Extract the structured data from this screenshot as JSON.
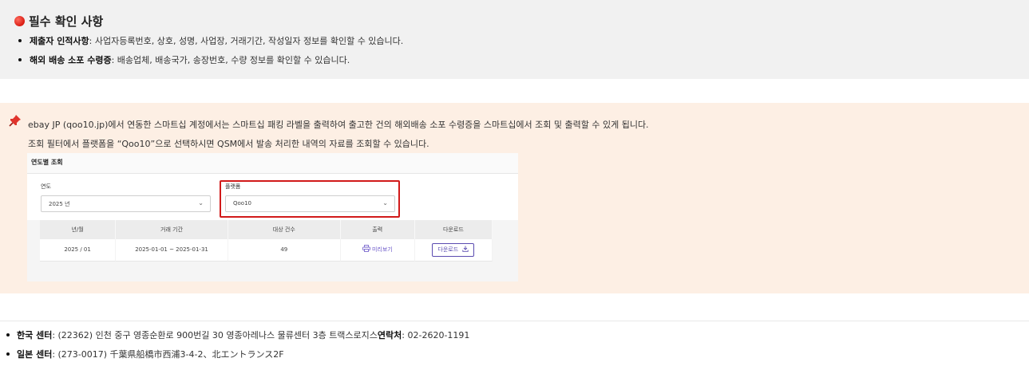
{
  "notice": {
    "title": "필수 확인 사항",
    "items": [
      {
        "label": "제출자 인적사항",
        "text": " :  사업자등록번호, 상호, 성명, 사업장, 거래기간, 작성일자 정보를 확인할 수 있습니다."
      },
      {
        "label": "해외 배송 소포 수령증",
        "text": " : 배송업체, 배송국가, 송장번호, 수량 정보를 확인할 수 있습니다."
      }
    ]
  },
  "info": {
    "line1": "ebay JP (qoo10.jp)에서 연동한 스마트십 계정에서는 스마트십 패킹 라벨을 출력하여 출고한 건의 해외배송 소포 수령증을 스마트십에서 조회 및 출력할 수 있게 됩니다.",
    "line2": "조회 필터에서 플랫폼을 “Qoo10”으로 선택하시면 QSM에서 발송 처리한 내역의 자료를 조회할 수 있습니다."
  },
  "screenshot": {
    "header": "연도별 조회",
    "year_label": "연도",
    "year_value": "2025 년",
    "platform_label": "플랫폼",
    "platform_value": "Qoo10",
    "columns": [
      "년/월",
      "거래 기간",
      "대상 건수",
      "출력",
      "다운로드"
    ],
    "rows": [
      {
        "month": "2025 / 01",
        "period": "2025-01-01 ~ 2025-01-31",
        "count": "49",
        "preview": "미리보기",
        "download": "다운로드"
      }
    ]
  },
  "footer": {
    "korea_label": "한국 센터",
    "korea_address": " : (22362) 인천 중구 영종순환로 900번길 30 영종아레나스 물류센터 3층 트랙스로지스 ",
    "contact_label": "연락처",
    "contact_value": " : 02-2620-1191",
    "japan_label": "일본 센터",
    "japan_address": " : (273-0017)  千葉県船橋市西浦3-4-2、北エントランス2F"
  }
}
